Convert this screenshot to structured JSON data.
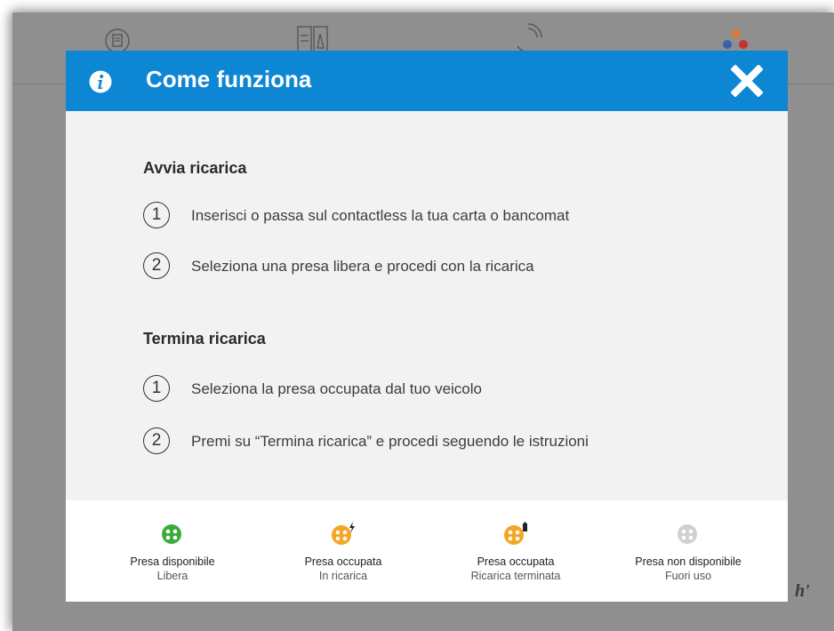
{
  "modal": {
    "title": "Come funziona",
    "close_icon": "close-x-icon",
    "info_icon": "info-circle-icon",
    "header_color": "#0d86d4"
  },
  "sections": [
    {
      "title": "Avvia ricarica",
      "steps": [
        {
          "num": "1",
          "text": "Inserisci o passa sul contactless la tua carta o bancomat"
        },
        {
          "num": "2",
          "text": "Seleziona una presa libera e procedi con la ricarica"
        }
      ]
    },
    {
      "title": "Termina ricarica",
      "steps": [
        {
          "num": "1",
          "text": "Seleziona la presa occupata dal tuo veicolo"
        },
        {
          "num": "2",
          "text": "Premi su “Termina ricarica” e procedi seguendo le istruzioni"
        }
      ]
    }
  ],
  "legend": [
    {
      "title": "Presa disponibile",
      "subtitle": "Libera",
      "icon": "socket-available-icon",
      "color": "#3cab3c"
    },
    {
      "title": "Presa occupata",
      "subtitle": "In ricarica",
      "icon": "socket-charging-icon",
      "color": "#f5a623"
    },
    {
      "title": "Presa occupata",
      "subtitle": "Ricarica terminata",
      "icon": "socket-charged-icon",
      "color": "#f5a623"
    },
    {
      "title": "Presa non disponibile",
      "subtitle": "Fuori uso",
      "icon": "socket-unavailable-icon",
      "color": "#d0d0d0"
    }
  ],
  "background": {
    "toolbar_icons": [
      "refresh-receipt-icon",
      "documents-icon",
      "phone-call-icon",
      "language-flags-icon"
    ]
  }
}
